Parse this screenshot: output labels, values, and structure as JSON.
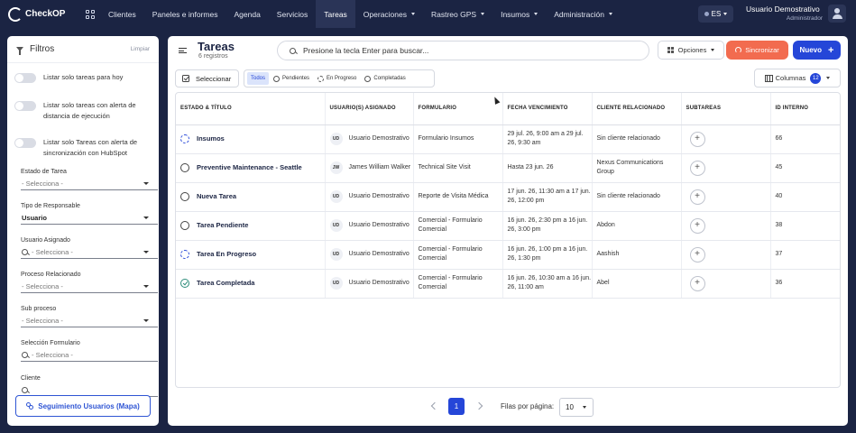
{
  "app": {
    "logo_text": "CheckOP"
  },
  "nav": {
    "items": [
      {
        "label": "Clientes",
        "dropdown": false
      },
      {
        "label": "Paneles e informes",
        "dropdown": false
      },
      {
        "label": "Agenda",
        "dropdown": false
      },
      {
        "label": "Servicios",
        "dropdown": false
      },
      {
        "label": "Tareas",
        "dropdown": false,
        "active": true
      },
      {
        "label": "Operaciones",
        "dropdown": true
      },
      {
        "label": "Rastreo GPS",
        "dropdown": true
      },
      {
        "label": "Insumos",
        "dropdown": true
      },
      {
        "label": "Administración",
        "dropdown": true
      }
    ],
    "language": "ES",
    "user_name": "Usuario Demostrativo",
    "user_role": "Administrador"
  },
  "sidebar": {
    "title": "Filtros",
    "clear_label": "Limpiar",
    "toggles": [
      "Listar solo tareas para hoy",
      "Listar solo tareas con alerta de distancia de ejecución",
      "Listar solo Tareas con alerta de sincronización con HubSpot"
    ],
    "fields": {
      "estado": {
        "label": "Estado de Tarea",
        "value": "- Selecciona -"
      },
      "responsable": {
        "label": "Tipo de Responsable",
        "value": "Usuario"
      },
      "usuario": {
        "label": "Usuario Asignado",
        "value": "- Selecciona -"
      },
      "proceso": {
        "label": "Proceso Relacionado",
        "value": "- Selecciona -"
      },
      "subproceso": {
        "label": "Sub proceso",
        "value": "- Selecciona -"
      },
      "formulario": {
        "label": "Selección Formulario",
        "value": "- Selecciona -"
      },
      "cliente": {
        "label": "Cliente"
      }
    },
    "map_button": "Seguimiento Usuarios (Mapa)"
  },
  "main": {
    "title": "Tareas",
    "subtitle": "6 registros",
    "search_placeholder": "Presione la tecla Enter para buscar...",
    "options_label": "Opciones",
    "sync_label": "Sincronizar",
    "new_label": "Nuevo",
    "select_label": "Seleccionar",
    "tabs": [
      "Todos",
      "Pendientes",
      "En Progreso",
      "Completadas"
    ],
    "columns_label": "Columnas",
    "columns_count": "12"
  },
  "table": {
    "headers": [
      "ESTADO & TÍTULO",
      "USUARIO(S) ASIGNADO",
      "FORMULARIO",
      "FECHA VENCIMIENTO",
      "CLIENTE RELACIONADO",
      "SUBTAREAS",
      "ID INTERNO"
    ],
    "rows": [
      {
        "title": "Insumos",
        "status": "progress",
        "initials": "UD",
        "user": "Usuario Demostrativo",
        "form": "Formulario Insumos",
        "due": "29 jul. 26, 9:00 am a 29 jul. 26, 9:30 am",
        "client": "Sin cliente relacionado",
        "id": "66"
      },
      {
        "title": "Preventive Maintenance - Seattle",
        "status": "pending",
        "initials": "JW",
        "user": "James William Walker",
        "form": "Technical Site Visit",
        "due": "Hasta 23 jun. 26",
        "client": "Nexus Communications Group",
        "id": "45"
      },
      {
        "title": "Nueva Tarea",
        "status": "pending",
        "initials": "UD",
        "user": "Usuario Demostrativo",
        "form": "Reporte de Visita Médica",
        "due": "17 jun. 26, 11:30 am a 17 jun. 26, 12:00 pm",
        "client": "Sin cliente relacionado",
        "id": "40"
      },
      {
        "title": "Tarea Pendiente",
        "status": "pending",
        "initials": "UD",
        "user": "Usuario Demostrativo",
        "form": "Comercial - Formulario Comercial",
        "due": "16 jun. 26, 2:30 pm a 16 jun. 26, 3:00 pm",
        "client": "Abdon",
        "id": "38"
      },
      {
        "title": "Tarea En Progreso",
        "status": "progress",
        "initials": "UD",
        "user": "Usuario Demostrativo",
        "form": "Comercial - Formulario Comercial",
        "due": "16 jun. 26, 1:00 pm a 16 jun. 26, 1:30 pm",
        "client": "Aashish",
        "id": "37"
      },
      {
        "title": "Tarea Completada",
        "status": "done",
        "initials": "UD",
        "user": "Usuario Demostrativo",
        "form": "Comercial - Formulario Comercial",
        "due": "16 jun. 26, 10:30 am a 16 jun. 26, 11:00 am",
        "client": "Abel",
        "id": "36"
      }
    ]
  },
  "pagination": {
    "current_page": "1",
    "per_page_label": "Filas por página:",
    "per_page": "10"
  },
  "colors": {
    "nav_bg": "#1b2443",
    "primary": "#2546d8",
    "sync": "#f26b4f",
    "done": "#2c8c7a"
  }
}
